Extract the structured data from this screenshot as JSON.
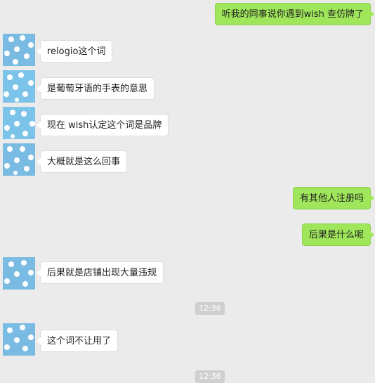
{
  "messages": [
    {
      "side": "out",
      "text": "听我的同事说你遇到wish 查仿牌了"
    },
    {
      "side": "in",
      "text": "relogio这个词"
    },
    {
      "side": "in",
      "text": "是葡萄牙语的手表的意思"
    },
    {
      "side": "in",
      "text": "现在 wish认定这个词是品牌"
    },
    {
      "side": "in",
      "text": "大概就是这么回事"
    },
    {
      "side": "out",
      "text": "有其他人注册吗"
    },
    {
      "side": "out",
      "text": "后果是什么呢"
    },
    {
      "side": "in",
      "text": "后果就是店铺出现大量违规"
    },
    {
      "side": "in",
      "text": "这个词不让用了"
    }
  ],
  "timestamps": [
    "12:36",
    "12:36"
  ],
  "icons": {
    "avatar": "avatar-icon"
  },
  "colors": {
    "background": "#ebebeb",
    "outgoing": "#9fe65a",
    "incoming": "#ffffff"
  }
}
